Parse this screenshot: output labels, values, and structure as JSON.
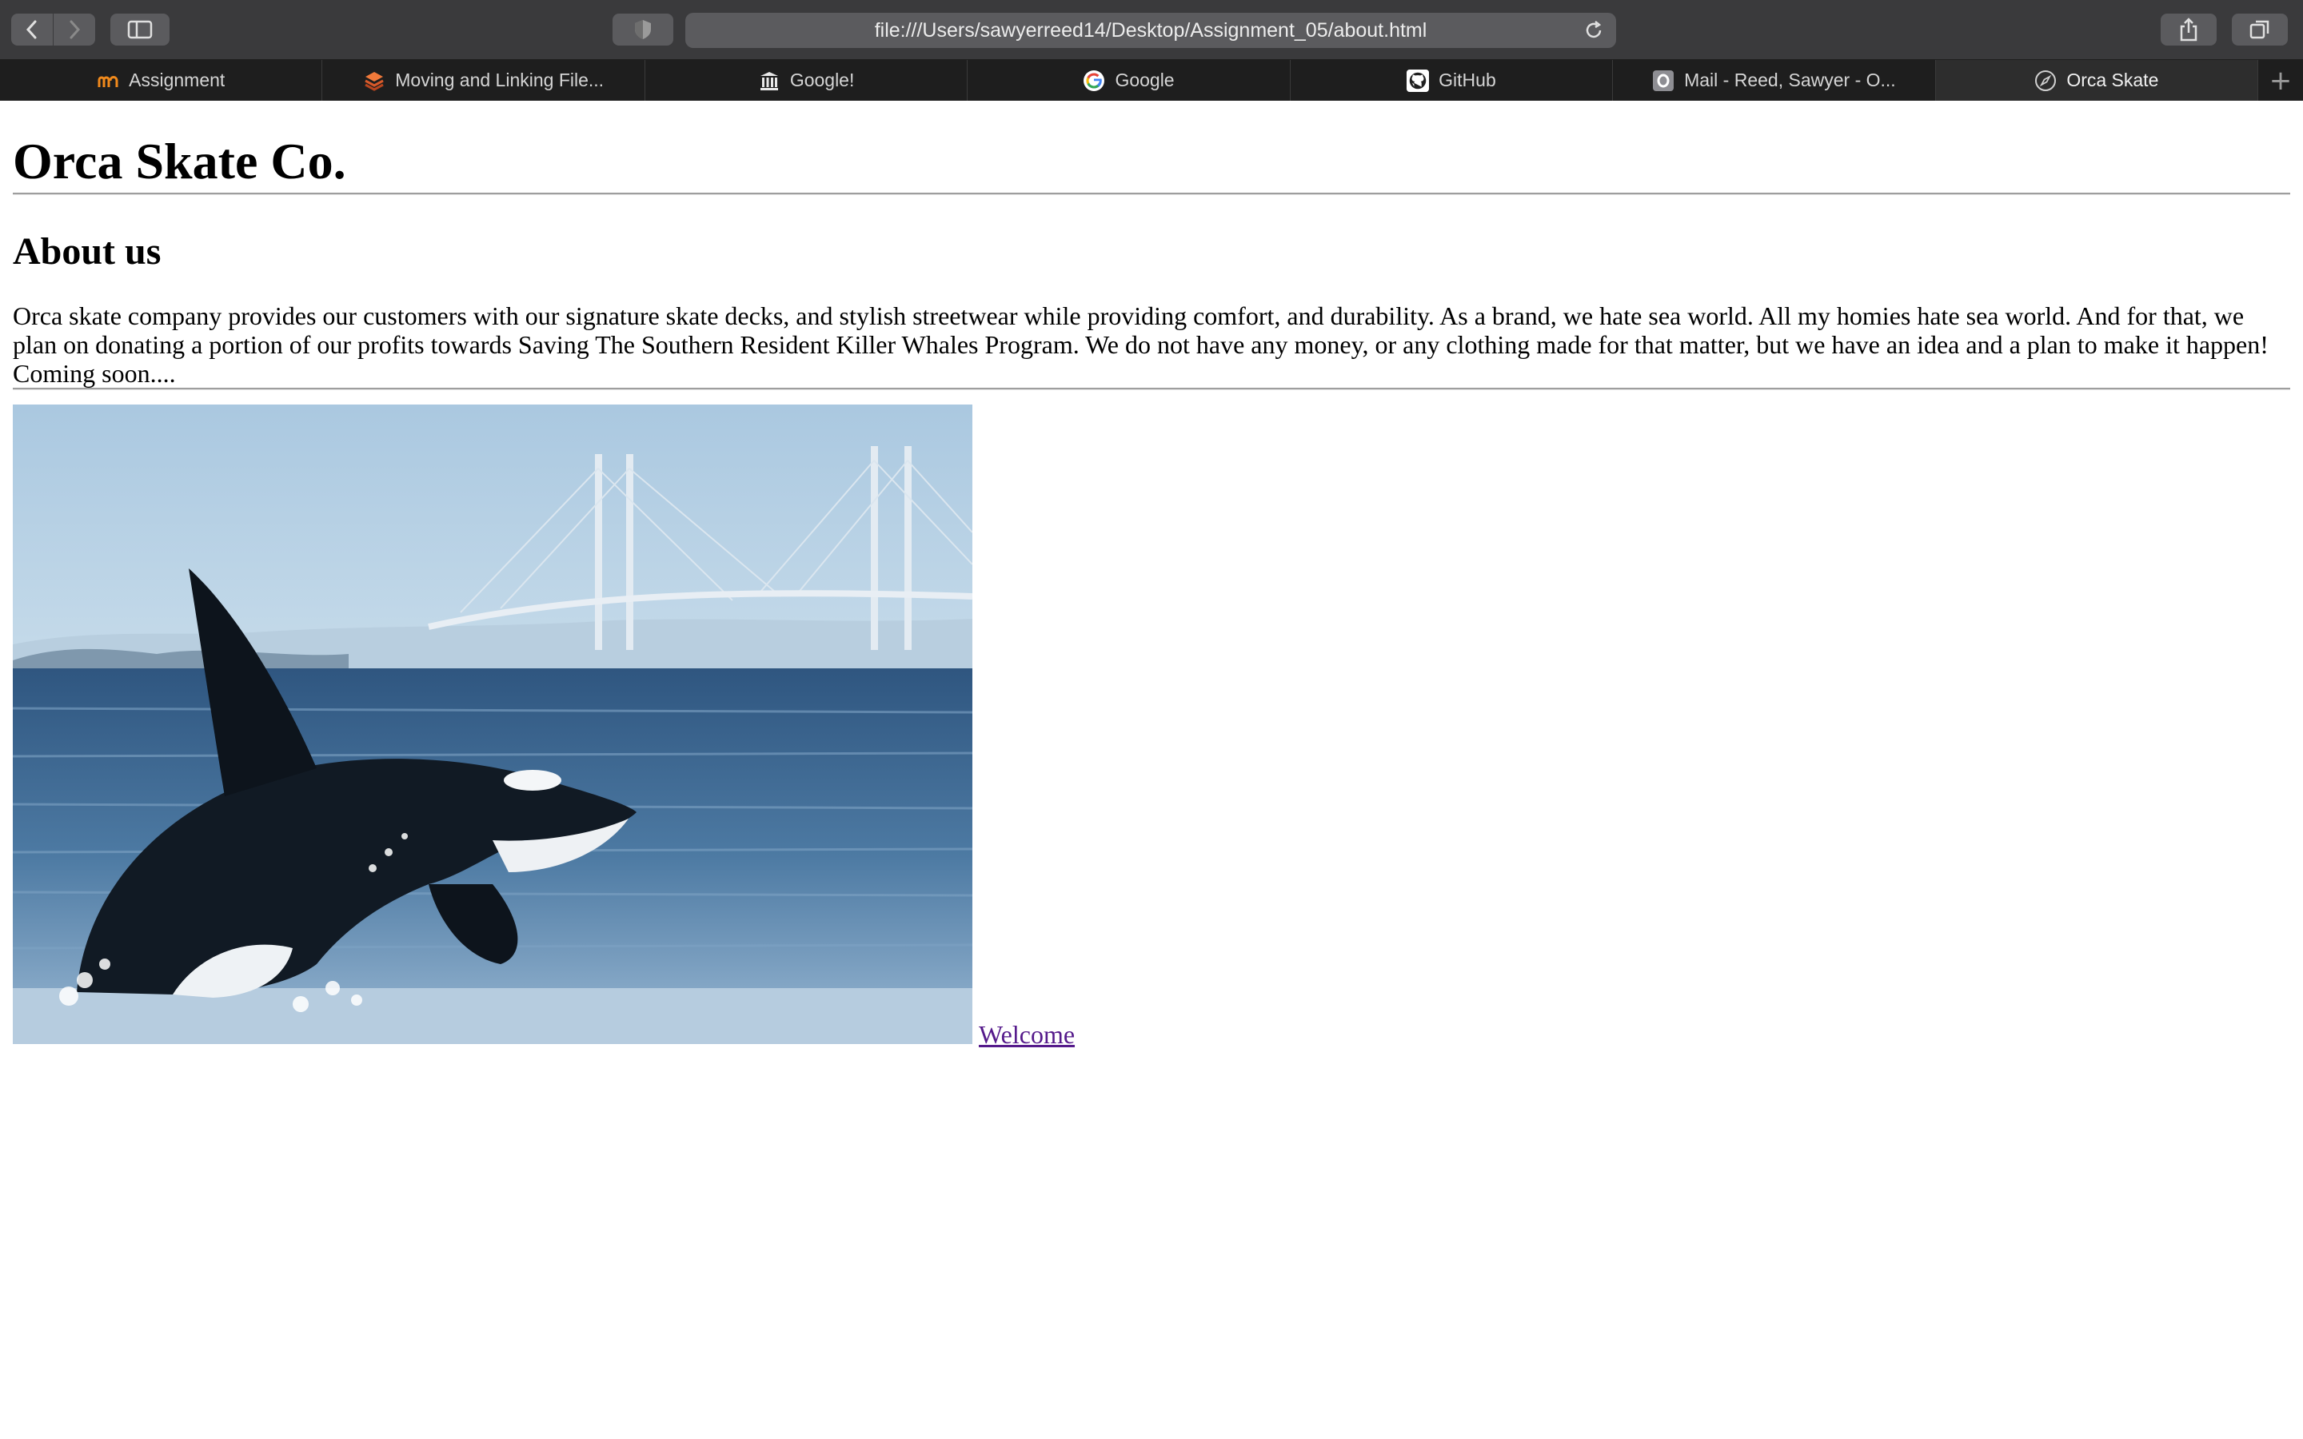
{
  "browser": {
    "url": "file:///Users/sawyerreed14/Desktop/Assignment_05/about.html",
    "tabs": [
      {
        "label": "Assignment",
        "icon": "moodle-icon",
        "active": false
      },
      {
        "label": "Moving and Linking File...",
        "icon": "layers-icon",
        "active": false
      },
      {
        "label": "Google!",
        "icon": "bank-icon",
        "active": false
      },
      {
        "label": "Google",
        "icon": "google-icon",
        "active": false
      },
      {
        "label": "GitHub",
        "icon": "github-icon",
        "active": false
      },
      {
        "label": "Mail - Reed, Sawyer - O...",
        "icon": "outlook-icon",
        "active": false
      },
      {
        "label": "Orca Skate",
        "icon": "compass-icon",
        "active": true
      }
    ],
    "new_tab": "+"
  },
  "page": {
    "title": "Orca Skate Co.",
    "about_heading": "About us",
    "about_text": "Orca skate company provides our customers with our signature skate decks, and stylish streetwear while providing comfort, and durability. As a brand, we hate sea world. All my homies hate sea world. And for that, we plan on donating a portion of our profits towards Saving The Southern Resident Killer Whales Program. We do not have any money, or any clothing made for that matter, but we have an idea and a plan to make it happen! Coming soon....",
    "image": "orca breaching in front of a cable-stayed bridge",
    "welcome_link": "Welcome"
  },
  "colors": {
    "toolbar": "#3a3a3c",
    "tabbar": "#1e1e1e",
    "visited_link": "#551a8b"
  }
}
